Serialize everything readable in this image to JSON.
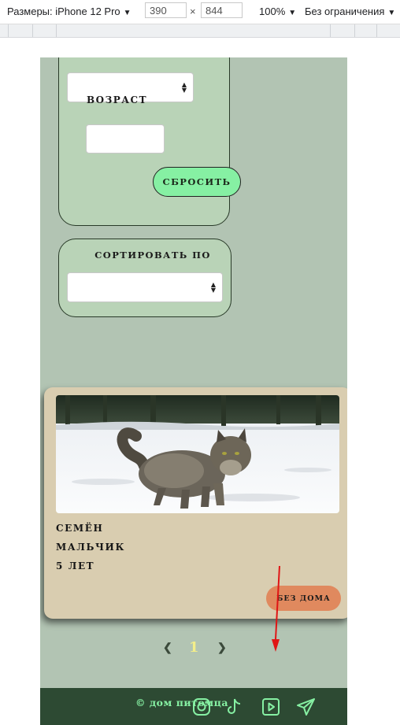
{
  "devtools": {
    "dimensions_label": "Размеры: iPhone 12 Pro",
    "width": "390",
    "times": "×",
    "height": "844",
    "zoom": "100%",
    "throttle": "Без ограничения"
  },
  "filters": {
    "age_label": "возраст",
    "reset_label": "сбросить"
  },
  "sort": {
    "title": "сортировать по"
  },
  "pet": {
    "name": "Семён",
    "gender": "мальчик",
    "age": "5 лет",
    "status": "без дома"
  },
  "pagination": {
    "prev": "❮",
    "current": "1",
    "next": "❯"
  },
  "footer": {
    "copyright": "© дом питомца"
  },
  "colors": {
    "page_bg": "#b2c4b3",
    "panel_bg": "#b9d3b7",
    "accent_green": "#86f0a3",
    "card_bg": "#d9cdb0",
    "status_orange": "#e0895e",
    "footer_bg": "#2d4a33",
    "pager_active": "#f3ee8a",
    "annotation_red": "#e01515"
  },
  "icons": [
    "instagram-icon",
    "tiktok-icon",
    "youtube-icon",
    "telegram-icon",
    "chevron-left-icon",
    "chevron-right-icon"
  ]
}
